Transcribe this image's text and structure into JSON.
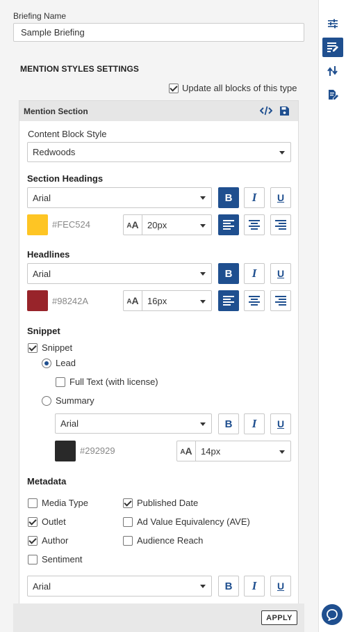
{
  "briefing": {
    "name_label": "Briefing Name",
    "name_value": "Sample Briefing"
  },
  "mention_styles": {
    "title": "MENTION STYLES SETTINGS",
    "update_all_label": "Update all blocks of this type",
    "update_all_checked": true
  },
  "card": {
    "title": "Mention Section",
    "code_icon": "code-icon",
    "save_icon": "save-icon"
  },
  "content_block": {
    "label": "Content Block Style",
    "value": "Redwoods"
  },
  "section_headings": {
    "label": "Section Headings",
    "font": "Arial",
    "color": "#FEC524",
    "color_label": "#FEC524",
    "size": "20px",
    "bold": true,
    "bold_label": "B",
    "italic_label": "I",
    "underline_label": "U",
    "align": "left"
  },
  "headlines": {
    "label": "Headlines",
    "font": "Arial",
    "color": "#98242A",
    "color_label": "#98242A",
    "size": "16px",
    "bold": true,
    "bold_label": "B",
    "italic_label": "I",
    "underline_label": "U",
    "align": "left"
  },
  "snippet": {
    "label": "Snippet",
    "checkbox_label": "Snippet",
    "checked": true,
    "lead_label": "Lead",
    "lead_selected": true,
    "full_text_label": "Full Text (with license)",
    "full_text_checked": false,
    "summary_label": "Summary",
    "summary_selected": false,
    "font": "Arial",
    "color": "#292929",
    "color_label": "#292929",
    "size": "14px",
    "bold_label": "B",
    "italic_label": "I",
    "underline_label": "U"
  },
  "metadata": {
    "label": "Metadata",
    "items": [
      {
        "label": "Media Type",
        "checked": false
      },
      {
        "label": "Published Date",
        "checked": true
      },
      {
        "label": "Outlet",
        "checked": true
      },
      {
        "label": "Ad Value Equivalency (AVE)",
        "checked": false
      },
      {
        "label": "Author",
        "checked": true
      },
      {
        "label": "Audience Reach",
        "checked": false
      },
      {
        "label": "Sentiment",
        "checked": false
      }
    ],
    "font": "Arial",
    "bold_label": "B",
    "italic_label": "I",
    "underline_label": "U"
  },
  "footer": {
    "apply_label": "APPLY"
  },
  "rail": {
    "items": [
      {
        "icon": "sliders-icon",
        "active": false
      },
      {
        "icon": "edit-style-icon",
        "active": true
      },
      {
        "icon": "sort-arrows-icon",
        "active": false
      },
      {
        "icon": "document-edit-icon",
        "active": false
      }
    ],
    "chat_icon": "chat-icon"
  },
  "colors": {
    "accent": "#1F4F8F",
    "panel_bg": "#F4F4F4",
    "header_bg": "#E6E6E6"
  }
}
